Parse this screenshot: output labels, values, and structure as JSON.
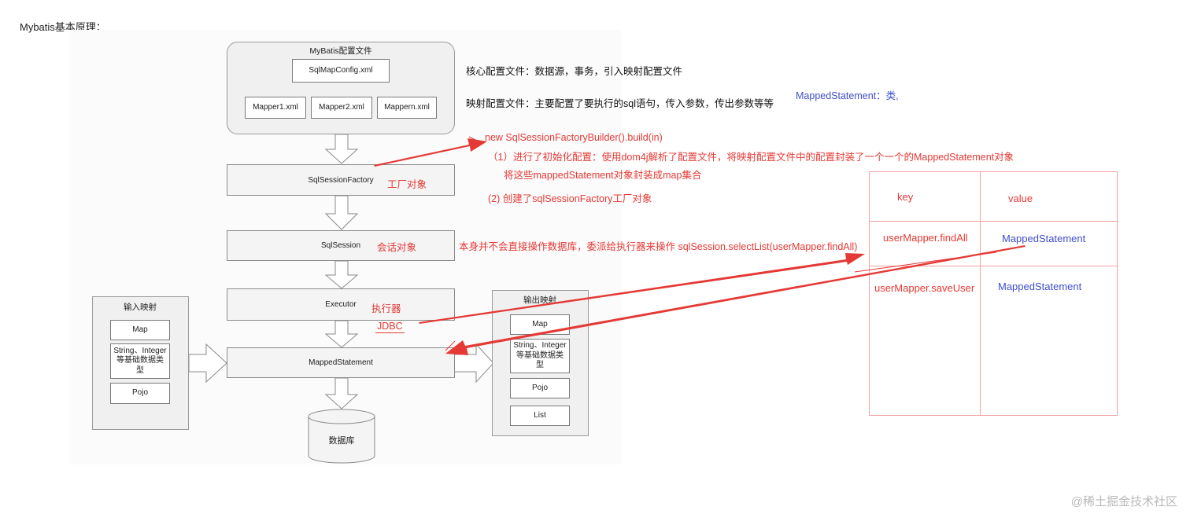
{
  "page_title": "Mybatis基本原理：",
  "config_group": {
    "label": "MyBatis配置文件",
    "core_file": "SqlMapConfig.xml",
    "mappers": [
      "Mapper1.xml",
      "Mapper2.xml",
      "Mappern.xml"
    ]
  },
  "flow": {
    "factory": "SqlSessionFactory",
    "session": "SqlSession",
    "executor": "Executor",
    "mapped": "MappedStatement",
    "db": "数据库"
  },
  "input_group": {
    "label": "输入映射",
    "items": [
      "Map",
      "String、Integer等基础数据类型",
      "Pojo"
    ]
  },
  "output_group": {
    "label": "输出映射",
    "items": [
      "Map",
      "String、Integer等基础数据类型",
      "Pojo",
      "List"
    ]
  },
  "notes": {
    "core_config": "核心配置文件：数据源，事务，引入映射配置文件",
    "mapping_config": "映射配置文件：主要配置了要执行的sql语句，传入参数，传出参数等等",
    "mapped_class": "MappedStatement：类,",
    "build": "new SqlSessionFactoryBuilder().build(in)",
    "step1": "（1）进行了初始化配置：使用dom4j解析了配置文件，将映射配置文件中的配置封装了一个一个的MappedStatement对象",
    "step1b": "将这些mappedStatement对象封装成map集合",
    "step2": "(2) 创建了sqlSessionFactory工厂对象",
    "factory_obj": "工厂对象",
    "session_obj": "会话对象",
    "session_desc": "本身并不会直接操作数据库，委派给执行器来操作 sqlSession.selectList(userMapper.findAll)",
    "executor": "执行器",
    "jdbc": "JDBC"
  },
  "map_table": {
    "header": {
      "key": "key",
      "value": "value"
    },
    "rows": [
      {
        "key": "userMapper.findAll",
        "value": "MappedStatement"
      },
      {
        "key": "userMapper.saveUser",
        "value": "MappedStatement"
      }
    ]
  },
  "colors": {
    "annotation_red": "#e53935",
    "annotation_blue": "#3e4fc9",
    "table_border": "#f2a0a0"
  },
  "watermark": "@稀土掘金技术社区"
}
